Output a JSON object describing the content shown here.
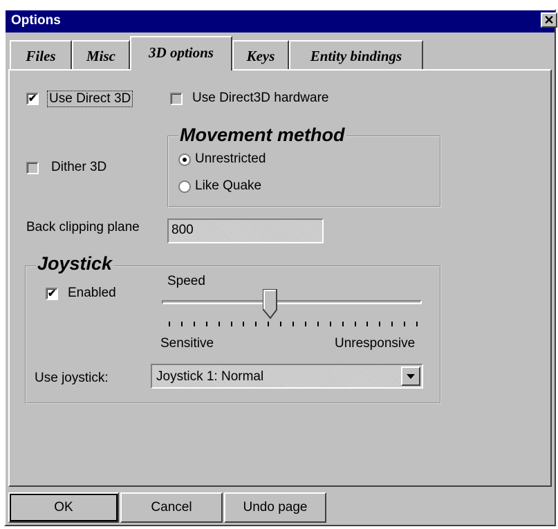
{
  "window": {
    "title": "Options",
    "close_glyph": "✕"
  },
  "tabs": [
    {
      "label": "Files"
    },
    {
      "label": "Misc"
    },
    {
      "label": "3D options"
    },
    {
      "label": "Keys"
    },
    {
      "label": "Entity bindings"
    }
  ],
  "options3d": {
    "use_direct3d": {
      "label": "Use Direct 3D",
      "checked": true
    },
    "use_direct3d_hw": {
      "label": "Use Direct3D hardware",
      "checked": false
    },
    "dither3d": {
      "label": "Dither 3D",
      "checked": false
    },
    "movement": {
      "title": "Movement method",
      "options": [
        {
          "label": "Unrestricted",
          "selected": true
        },
        {
          "label": "Like Quake",
          "selected": false
        }
      ]
    },
    "back_clipping": {
      "label": "Back clipping plane",
      "value": "800"
    }
  },
  "joystick": {
    "title": "Joystick",
    "enabled": {
      "label": "Enabled",
      "checked": true
    },
    "speed_label": "Speed",
    "speed_value": 0.41,
    "min_label": "Sensitive",
    "max_label": "Unresponsive",
    "use_label": "Use joystick:",
    "selected": "Joystick 1: Normal"
  },
  "buttons": {
    "ok": "OK",
    "cancel": "Cancel",
    "undo": "Undo page"
  },
  "colors": {
    "titlebar": "#00007b",
    "face": "#c0c0c0"
  }
}
